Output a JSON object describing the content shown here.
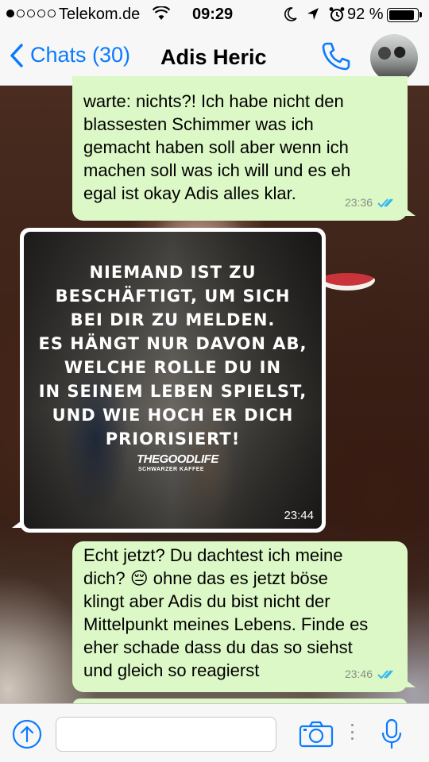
{
  "status_bar": {
    "carrier": "Telekom.de",
    "time": "09:29",
    "battery_percent": "92 %",
    "battery_level": 0.92,
    "signal_bars": 1
  },
  "nav": {
    "back_label": "Chats (30)",
    "contact_name": "Adis Heric",
    "call_icon": "phone-icon",
    "avatar_icon": "contact-avatar"
  },
  "messages": [
    {
      "direction": "outgoing",
      "lines": [
        "warte: nichts?! Ich habe nicht den",
        "blassesten Schimmer was ich",
        "gemacht haben soll aber wenn ich",
        "machen soll was ich will und es eh",
        "egal ist okay Adis alles klar."
      ],
      "time": "23:36",
      "status": "read"
    },
    {
      "direction": "incoming",
      "type": "image",
      "image_text": [
        "NIEMAND IST ZU",
        "BESCHÄFTIGT, UM SICH",
        "BEI DIR ZU MELDEN.",
        "ES HÄNGT NUR DAVON AB,",
        "WELCHE ROLLE DU IN",
        "IN SEINEM LEBEN SPIELST,",
        "UND WIE HOCH ER DICH",
        "PRIORISIERT!"
      ],
      "brand": "THEGOODLIFE",
      "brand_sub": "SCHWARZER KAFFEE",
      "time": "23:44"
    },
    {
      "direction": "outgoing",
      "lines": [
        "Echt jetzt? Du dachtest ich meine",
        "dich? 😔 ohne das es jetzt böse",
        "klingt aber Adis du bist nicht der",
        "Mittelpunkt meines Lebens. Finde es",
        "eher schade dass du das so siehst",
        "und gleich so reagierst"
      ],
      "time": "23:46",
      "status": "read"
    }
  ],
  "input_bar": {
    "placeholder": "",
    "icons": [
      "share-icon",
      "camera-icon",
      "microphone-icon"
    ]
  },
  "colors": {
    "accent": "#0a7bff",
    "outgoing_bubble": "#dcf8c6",
    "read_ticks": "#34b7f1"
  }
}
